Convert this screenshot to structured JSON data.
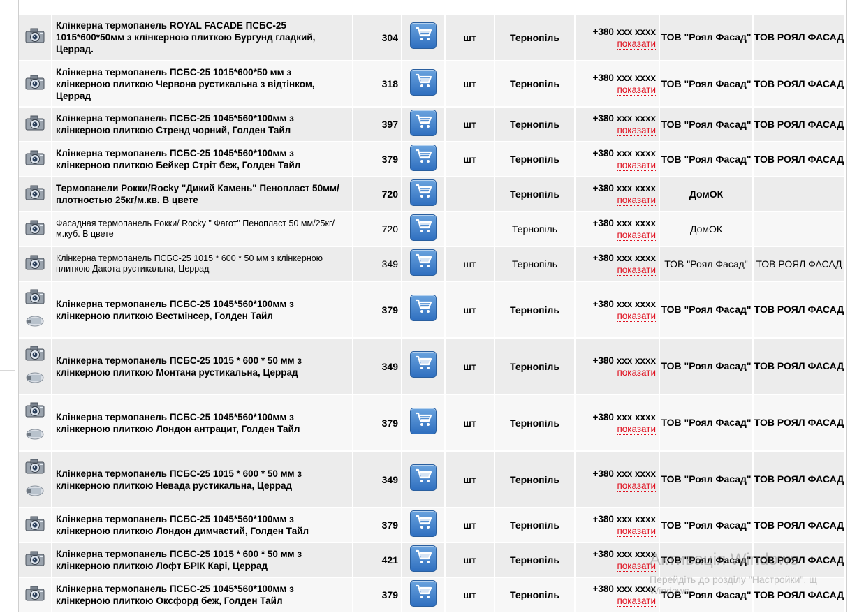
{
  "rows": [
    {
      "name": "Клінкерна термопанель ROYAL FACADE ПСБС-25 1015*600*50мм з клінкерною плиткою Бургунд гладкий, Церрад.",
      "price": "304",
      "unit": "шт",
      "city": "Тернопіль",
      "phone": "+380 xxx xxxx",
      "show": "показати",
      "company": "ТОВ \"Роял Фасад\"",
      "seller": "ТОВ РОЯЛ ФАСАД"
    },
    {
      "name": "Клінкерна термопанель ПСБС-25 1015*600*50 мм з клінкерною плиткою Червона рустикальна з відтінком, Церрад",
      "price": "318",
      "unit": "шт",
      "city": "Тернопіль",
      "phone": "+380 xxx xxxx",
      "show": "показати",
      "company": "ТОВ \"Роял Фасад\"",
      "seller": "ТОВ РОЯЛ ФАСАД"
    },
    {
      "name": "Клінкерна термопанель ПСБС-25 1045*560*100мм з клінкерною плиткою Стренд чорний, Голден Тайл",
      "price": "397",
      "unit": "шт",
      "city": "Тернопіль",
      "phone": "+380 xxx xxxx",
      "show": "показати",
      "company": "ТОВ \"Роял Фасад\"",
      "seller": "ТОВ РОЯЛ ФАСАД"
    },
    {
      "name": "Клінкерна термопанель ПСБС-25 1045*560*100мм з клінкерною плиткою Бейкер Стріт беж, Голден Тайл",
      "price": "379",
      "unit": "шт",
      "city": "Тернопіль",
      "phone": "+380 xxx xxxx",
      "show": "показати",
      "company": "ТОВ \"Роял Фасад\"",
      "seller": "ТОВ РОЯЛ ФАСАД"
    },
    {
      "name": "Термопанели Рокки/Rocky \"Дикий Камень\" Пенопласт 50мм/плотностью 25кг/м.кв. В цвете",
      "price": "720",
      "unit": "",
      "city": "Тернопіль",
      "phone": "+380 xxx xxxx",
      "show": "показати",
      "company": "ДомОК",
      "seller": ""
    },
    {
      "name": "Фасадная термопанель Рокки/ Rocky \" Фагот\" Пенопласт 50 мм/25кг/м.куб. В цвете",
      "price": "720",
      "unit": "",
      "city": "Тернопіль",
      "phone": "+380 xxx xxxx",
      "show": "показати",
      "company": "ДомОК",
      "seller": ""
    },
    {
      "name": "Клінкерна термопанель ПСБС-25 1015 * 600 * 50 мм з клінкерною плиткою Дакота рустикальна, Церрад",
      "price": "349",
      "unit": "шт",
      "city": "Тернопіль",
      "phone": "+380 xxx xxxx",
      "show": "показати",
      "company": "ТОВ \"Роял Фасад\"",
      "seller": "ТОВ РОЯЛ ФАСАД"
    },
    {
      "name": "Клінкерна термопанель ПСБС-25 1045*560*100мм з клінкерною плиткою Вестмінсер, Голден Тайл",
      "price": "379",
      "unit": "шт",
      "city": "Тернопіль",
      "phone": "+380 xxx xxxx",
      "show": "показати",
      "company": "ТОВ \"Роял Фасад\"",
      "seller": "ТОВ РОЯЛ ФАСАД"
    },
    {
      "name": "Клінкерна термопанель ПСБС-25 1015 * 600 * 50 мм з клінкерною плиткою Монтана рустикальна, Церрад",
      "price": "349",
      "unit": "шт",
      "city": "Тернопіль",
      "phone": "+380 xxx xxxx",
      "show": "показати",
      "company": "ТОВ \"Роял Фасад\"",
      "seller": "ТОВ РОЯЛ ФАСАД"
    },
    {
      "name": "Клінкерна термопанель ПСБС-25 1045*560*100мм з клінкерною плиткою Лондон антрацит, Голден Тайл",
      "price": "379",
      "unit": "шт",
      "city": "Тернопіль",
      "phone": "+380 xxx xxxx",
      "show": "показати",
      "company": "ТОВ \"Роял Фасад\"",
      "seller": "ТОВ РОЯЛ ФАСАД"
    },
    {
      "name": "Клінкерна термопанель ПСБС-25 1015 * 600 * 50 мм з клінкерною плиткою Невада рустикальна, Церрад",
      "price": "349",
      "unit": "шт",
      "city": "Тернопіль",
      "phone": "+380 xxx xxxx",
      "show": "показати",
      "company": "ТОВ \"Роял Фасад\"",
      "seller": "ТОВ РОЯЛ ФАСАД"
    },
    {
      "name": "Клінкерна термопанель ПСБС-25 1045*560*100мм з клінкерною плиткою Лондон димчастий, Голден Тайл",
      "price": "379",
      "unit": "шт",
      "city": "Тернопіль",
      "phone": "+380 xxx xxxx",
      "show": "показати",
      "company": "ТОВ \"Роял Фасад\"",
      "seller": "ТОВ РОЯЛ ФАСАД"
    },
    {
      "name": "Клінкерна термопанель ПСБС-25 1015 * 600 * 50 мм з клінкерною плиткою Лофт БРІК Карі, Церрад",
      "price": "421",
      "unit": "шт",
      "city": "Тернопіль",
      "phone": "+380 xxx xxxx",
      "show": "показати",
      "company": "ТОВ \"Роял Фасад\"",
      "seller": "ТОВ РОЯЛ ФАСАД"
    },
    {
      "name": "Клінкерна термопанель ПСБС-25 1045*560*100мм з клінкерною плиткою Оксфорд беж, Голден Тайл",
      "price": "379",
      "unit": "шт",
      "city": "Тернопіль",
      "phone": "+380 xxx xxxx",
      "show": "показати",
      "company": "ТОВ \"Роял Фасад\"",
      "seller": "ТОВ РОЯЛ ФАСАД"
    }
  ],
  "watermark": {
    "line1": "Активація Windows",
    "line2": "Перейдіть до розділу \"Настройки\", щ",
    "line3": "Windows."
  },
  "icons": {
    "thumbnail": "camera-icon",
    "thumbnail_extra": "product-photo-icon",
    "cart": "cart-icon"
  },
  "colors": {
    "company_link": "#2a63c4",
    "show_link": "#e0101f",
    "cart_button": "#3f7fcc"
  }
}
